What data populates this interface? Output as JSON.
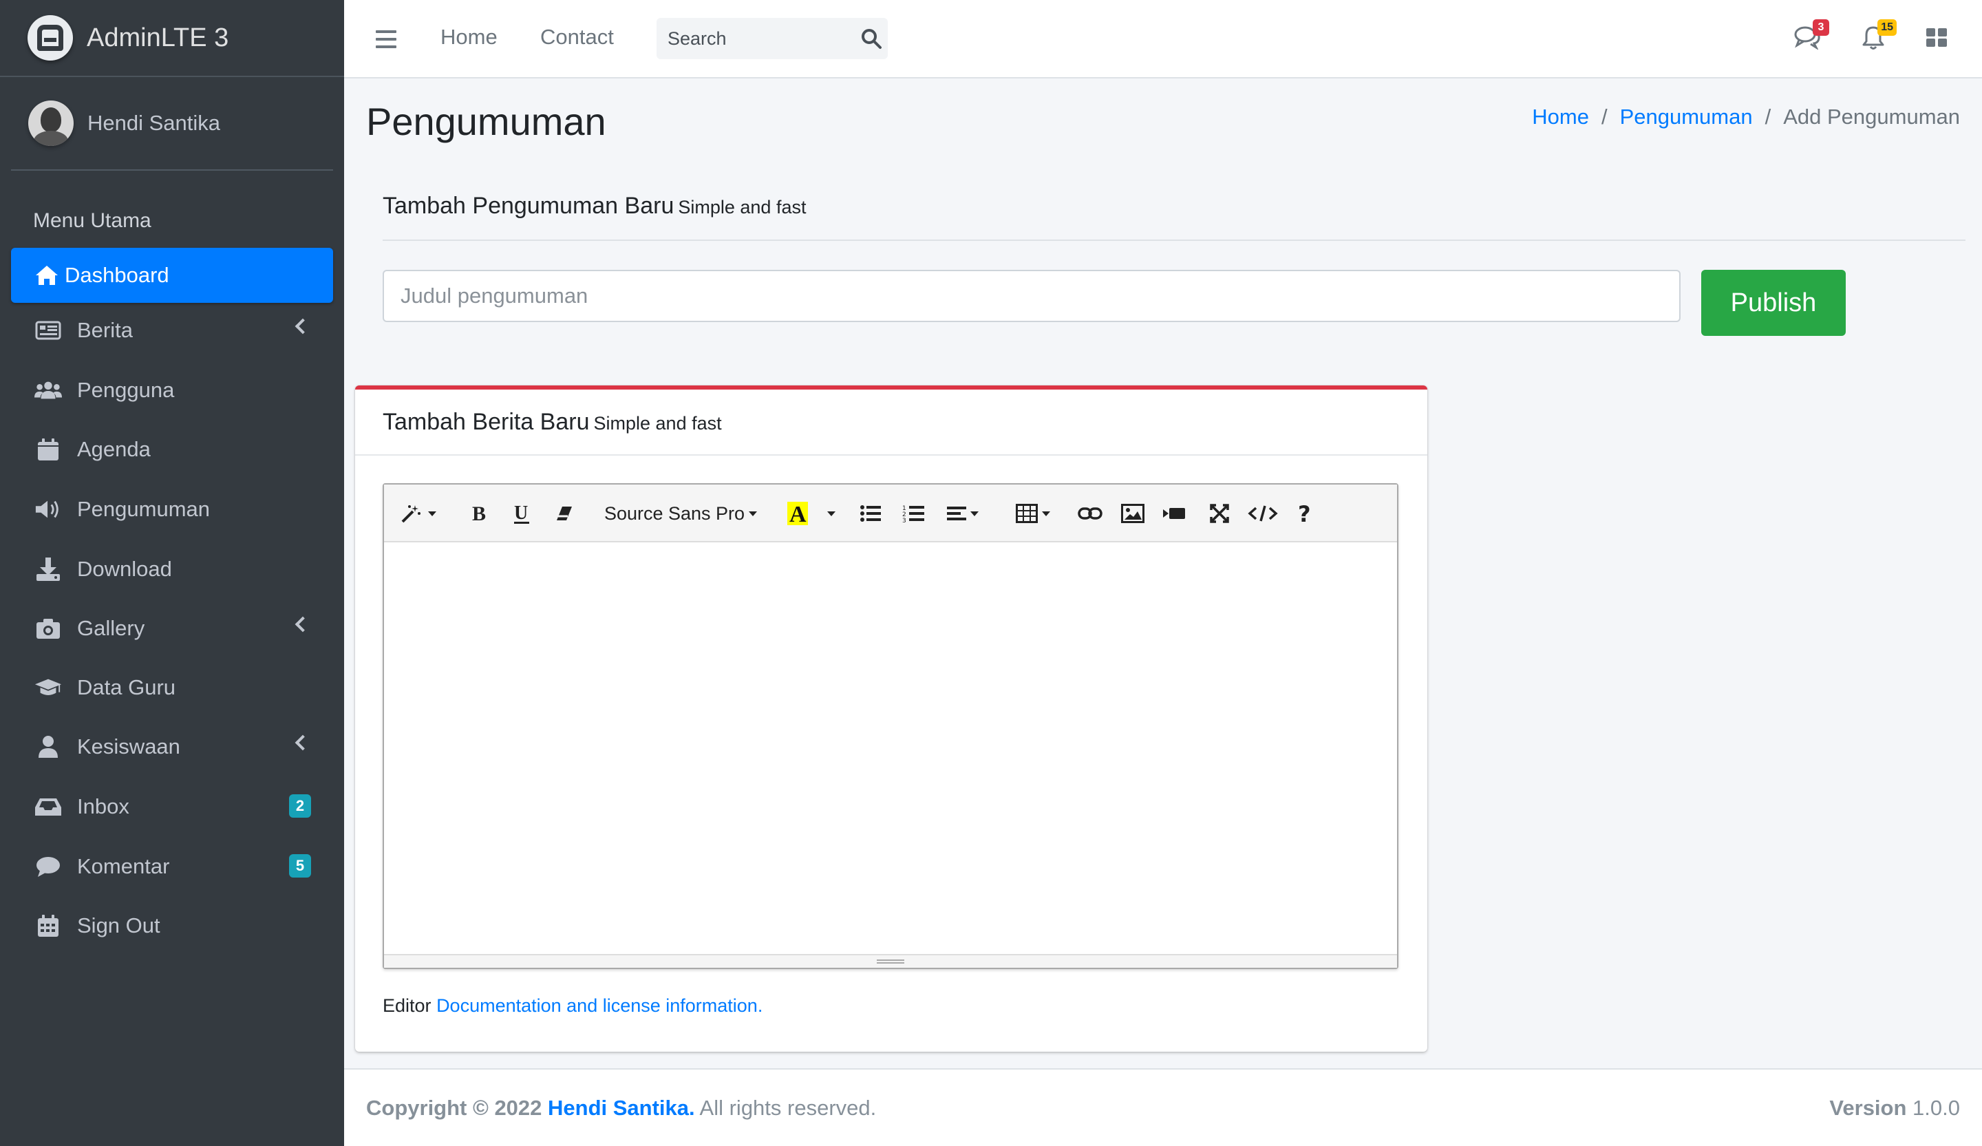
{
  "brand": {
    "name": "AdminLTE 3"
  },
  "user": {
    "name": "Hendi Santika"
  },
  "sidebar": {
    "header": "Menu Utama",
    "items": [
      {
        "label": "Dashboard",
        "icon": "home-icon",
        "active": true
      },
      {
        "label": "Berita",
        "icon": "newspaper-icon",
        "has_arrow": true
      },
      {
        "label": "Pengguna",
        "icon": "users-icon"
      },
      {
        "label": "Agenda",
        "icon": "calendar-icon"
      },
      {
        "label": "Pengumuman",
        "icon": "bullhorn-icon"
      },
      {
        "label": "Download",
        "icon": "download-icon"
      },
      {
        "label": "Gallery",
        "icon": "camera-icon",
        "has_arrow": true
      },
      {
        "label": "Data Guru",
        "icon": "graduation-cap-icon"
      },
      {
        "label": "Kesiswaan",
        "icon": "user-icon",
        "has_arrow": true
      },
      {
        "label": "Inbox",
        "icon": "inbox-icon",
        "badge": "2"
      },
      {
        "label": "Komentar",
        "icon": "comment-icon",
        "badge": "5"
      },
      {
        "label": "Sign Out",
        "icon": "calendar-grid-icon"
      }
    ]
  },
  "navbar": {
    "links": {
      "home": "Home",
      "contact": "Contact"
    },
    "search": {
      "placeholder": "Search"
    },
    "messages_badge": "3",
    "notifications_badge": "15"
  },
  "page": {
    "title": "Pengumuman",
    "breadcrumb": {
      "home": "Home",
      "section": "Pengumuman",
      "current": "Add Pengumuman"
    }
  },
  "form": {
    "section_title": "Tambah Pengumuman Baru",
    "section_subtitle": "Simple and fast",
    "title_placeholder": "Judul pengumuman",
    "publish_label": "Publish"
  },
  "card": {
    "title": "Tambah Berita Baru",
    "subtitle": "Simple and fast",
    "toolbar": {
      "font_name": "Source Sans Pro"
    },
    "note_prefix": "Editor",
    "note_link": "Documentation and license information."
  },
  "footer": {
    "copyright": "Copyright © 2022",
    "author": "Hendi Santika.",
    "rights": "All rights reserved.",
    "version_label": "Version",
    "version": "1.0.0"
  },
  "colors": {
    "sidebar_bg": "#343a40",
    "primary": "#007bff",
    "success": "#28a745",
    "danger": "#dc3545",
    "warning": "#ffc107",
    "info": "#17a2b8"
  }
}
